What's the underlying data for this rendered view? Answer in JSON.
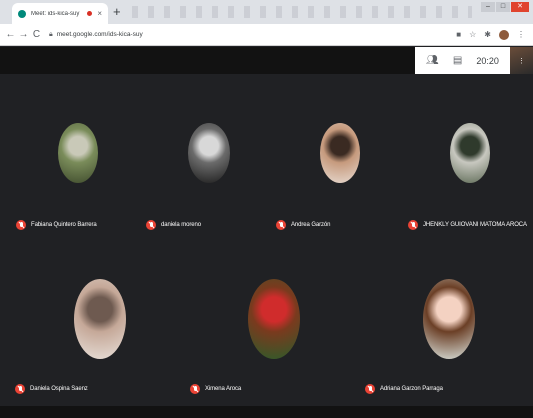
{
  "browser": {
    "tab_title": "Meet: ids-kica-suy",
    "tab_close": "×",
    "new_tab": "+",
    "back": "←",
    "forward": "→",
    "reload": "C",
    "url": "meet.google.com/ids-kica-suy",
    "window_minimize": "–",
    "window_maximize": "□",
    "window_close": "✕"
  },
  "meet": {
    "clock": "20:20",
    "people_icon": "people-icon",
    "chat_icon": "chat-icon"
  },
  "participants": [
    {
      "name": "Fabiana Quintero Barrera",
      "avatar_colors": [
        "#3e4a2c",
        "#7a8c5a",
        "#c9c9b8"
      ]
    },
    {
      "name": "daniela moreno",
      "avatar_colors": [
        "#1a1a1a",
        "#6b6b6b",
        "#d8d8d8"
      ]
    },
    {
      "name": "Andrea Garzón",
      "avatar_colors": [
        "#e8dcd3",
        "#c69a7d",
        "#3a2a22"
      ]
    },
    {
      "name": "JHENKLY GUIOVANI MATOMA AROCA",
      "avatar_colors": [
        "#5d6a55",
        "#c8c8c0",
        "#2f3a2c"
      ]
    },
    {
      "name": "Daniela Ospina Saenz",
      "avatar_colors": [
        "#e9e2dc",
        "#c5a898",
        "#6e5a50"
      ]
    },
    {
      "name": "Ximena Aroca",
      "avatar_colors": [
        "#2b5d2b",
        "#7a3a1e",
        "#d02c2c"
      ]
    },
    {
      "name": "Adriana Garzon Parraga",
      "avatar_colors": [
        "#dfe9e4",
        "#6b3f26",
        "#f4d2c2"
      ]
    }
  ]
}
